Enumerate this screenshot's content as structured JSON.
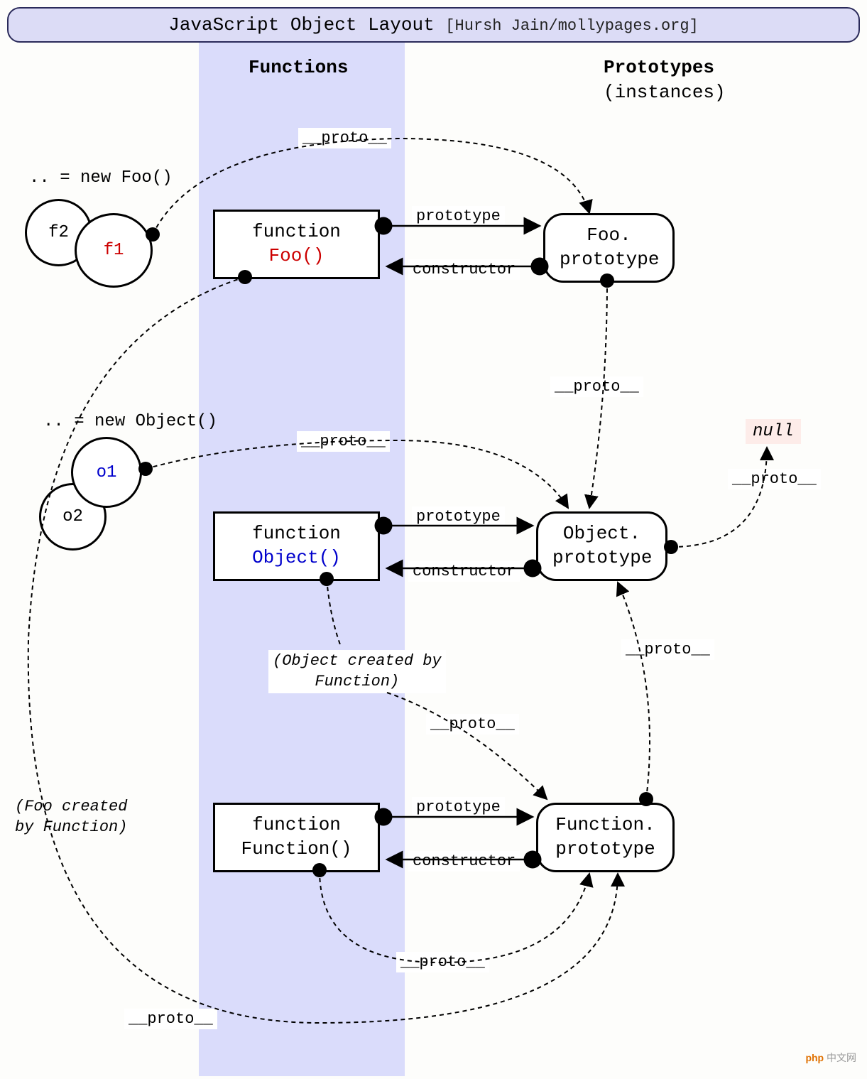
{
  "title": {
    "main": "JavaScript Object Layout",
    "sub": "[Hursh Jain/mollypages.org]"
  },
  "columns": {
    "functions": "Functions",
    "prototypes": "Prototypes",
    "instances": "(instances)"
  },
  "instances": {
    "foo_new": ".. = new Foo()",
    "f1": "f1",
    "f2": "f2",
    "obj_new": ".. = new Object()",
    "o1": "o1",
    "o2": "o2"
  },
  "functions": {
    "foo": {
      "word": "function",
      "name": "Foo()"
    },
    "object": {
      "word": "function",
      "name": "Object()"
    },
    "function": {
      "word": "function",
      "name": "Function()"
    }
  },
  "prototypes": {
    "foo": {
      "line1": "Foo.",
      "line2": "prototype"
    },
    "object": {
      "line1": "Object.",
      "line2": "prototype"
    },
    "function": {
      "line1": "Function.",
      "line2": "prototype"
    }
  },
  "labels": {
    "proto": "__proto__",
    "prototype": "prototype",
    "constructor": "constructor",
    "null": "null",
    "obj_created": "(Object created by",
    "obj_created2": "Function)",
    "foo_created": "(Foo created",
    "foo_created2": "by Function)"
  },
  "watermark": {
    "brand": "php",
    "text": "中文网"
  }
}
